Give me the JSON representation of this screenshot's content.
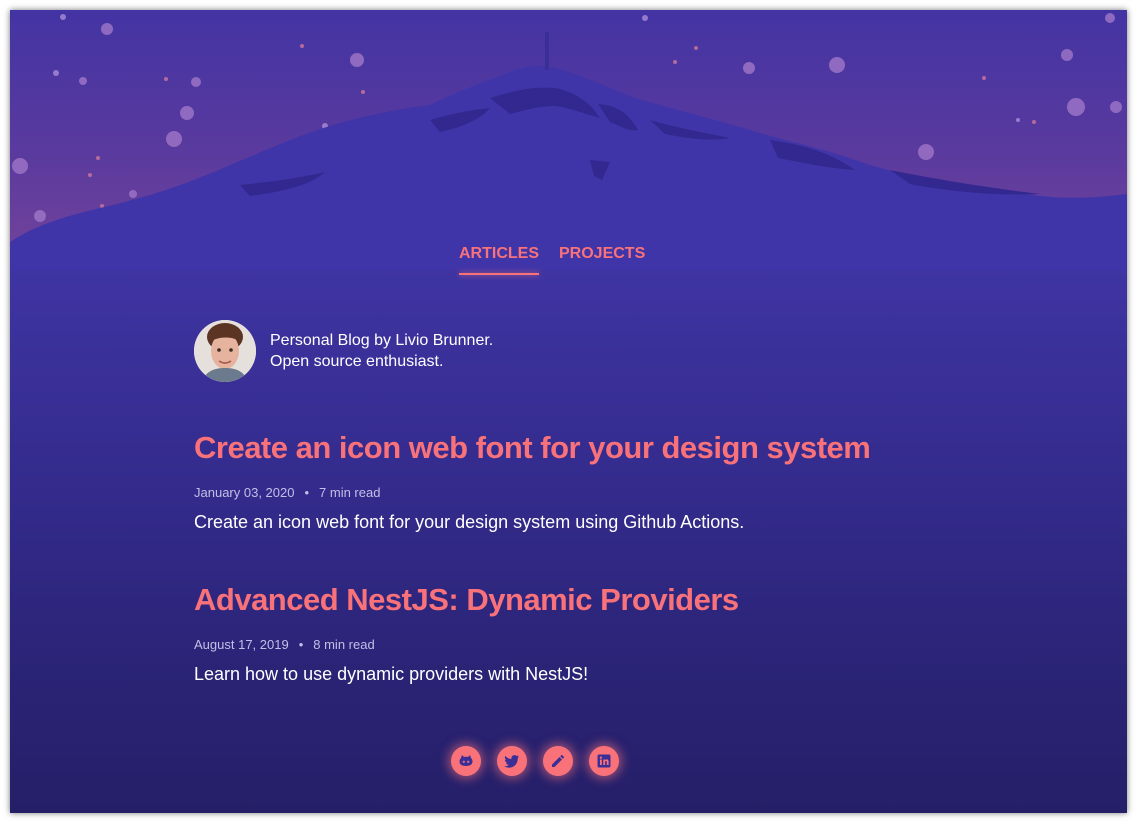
{
  "nav": {
    "tabs": [
      {
        "label": "ARTICLES",
        "active": true
      },
      {
        "label": "PROJECTS",
        "active": false
      }
    ]
  },
  "bio": {
    "line1": "Personal Blog by Livio Brunner.",
    "line2": "Open source enthusiast."
  },
  "posts": [
    {
      "title": "Create an icon web font for your design system",
      "date": "January 03, 2020",
      "read_time": "7 min read",
      "separator": "•",
      "description": "Create an icon web font for your design system using Github Actions."
    },
    {
      "title": "Advanced NestJS: Dynamic Providers",
      "date": "August 17, 2019",
      "read_time": "8 min read",
      "separator": "•",
      "description": "Learn how to use dynamic providers with NestJS!"
    }
  ],
  "social": [
    {
      "icon": "github-icon"
    },
    {
      "icon": "twitter-icon"
    },
    {
      "icon": "pencil-icon"
    },
    {
      "icon": "linkedin-icon"
    }
  ],
  "colors": {
    "accent": "#f9727a",
    "background_top": "#3f36a6",
    "background_bottom": "#251f68",
    "sky": "#6b3f97",
    "mountain_shadow": "#2f2489"
  }
}
